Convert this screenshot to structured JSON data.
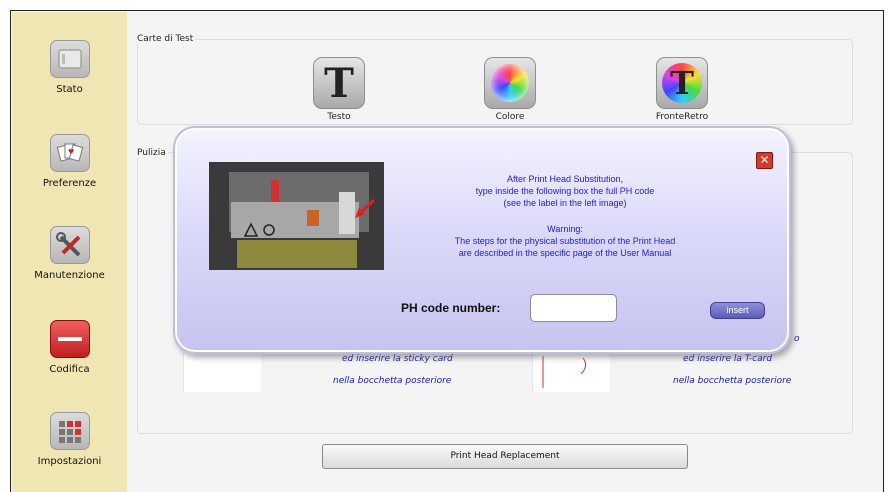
{
  "sidebar": {
    "items": [
      {
        "label": "Stato",
        "icon": "printer-icon"
      },
      {
        "label": "Preferenze",
        "icon": "cards-icon"
      },
      {
        "label": "Manutenzione",
        "icon": "tools-icon"
      },
      {
        "label": "Codifica",
        "icon": "card-stripe-icon"
      },
      {
        "label": "Impostazioni",
        "icon": "grid-settings-icon"
      }
    ]
  },
  "test_cards": {
    "title": "Carte di Test",
    "items": [
      {
        "label": "Testo",
        "glyph": "T"
      },
      {
        "label": "Colore",
        "glyph": ""
      },
      {
        "label": "FronteRetro",
        "glyph": "T"
      }
    ]
  },
  "cleaning": {
    "title": "Pulizia",
    "left_lines": [
      "ed inserire la sticky card",
      "nella bocchetta posteriore"
    ],
    "right_lines": [
      "o",
      "ed inserire la T-card",
      "nella bocchetta posteriore"
    ]
  },
  "replace_button": "Print Head Replacement",
  "dialog": {
    "close_glyph": "✕",
    "line1": "After Print Head Substitution,",
    "line2": "type inside the following box the full PH code",
    "line3": "(see the label in the left image)",
    "warning_title": "Warning:",
    "warning1": "The steps for the physical substitution of the Print Head",
    "warning2": "are described in the specific page of the User Manual",
    "ph_label": "PH code number:",
    "ph_value": "",
    "insert_label": "insert"
  }
}
